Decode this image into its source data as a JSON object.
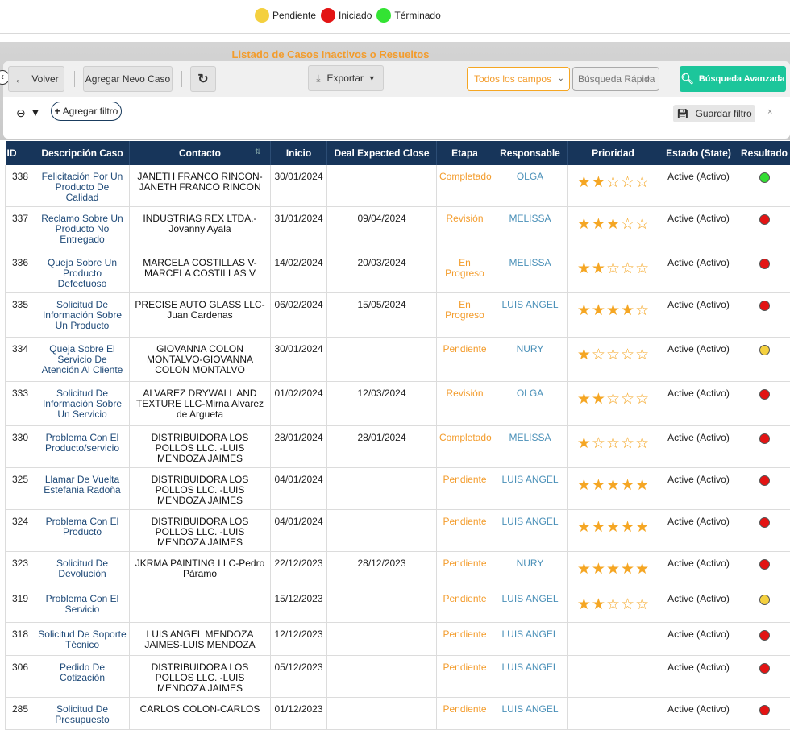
{
  "legend": [
    {
      "label": "Pendiente",
      "color": "#f4d03f"
    },
    {
      "label": "Iniciado",
      "color": "#e31414"
    },
    {
      "label": "Términado",
      "color": "#33e333"
    }
  ],
  "page_title": "Listado de Casos Inactivos o Resueltos",
  "toolbar": {
    "back_label": "Volver",
    "add_case_label": "Agregar Nevo Caso",
    "export_label": "Exportar",
    "fields_select_value": "Todos los campos",
    "quick_search_placeholder": "Búsqueda Rápida",
    "advanced_search_label": "Búsqueda Avanzada"
  },
  "filters": {
    "add_filter_label": "Agregar filtro",
    "save_filter_label": "Guardar filtro"
  },
  "table": {
    "columns": [
      "ID",
      "Descripción Caso",
      "Contacto",
      "Inicio",
      "Deal Expected Close",
      "Etapa",
      "Responsable",
      "Prioridad",
      "Estado (State)",
      "Resultado"
    ],
    "rows": [
      {
        "id": "338",
        "desc": "Felicitación Por Un Producto De Calidad",
        "contact": "JANETH FRANCO RINCON-JANETH FRANCO RINCON",
        "start": "30/01/2024",
        "close": "",
        "stage": "Completado",
        "owner": "OLGA",
        "priority": 2,
        "state": "Active (Activo)",
        "result": "green"
      },
      {
        "id": "337",
        "desc": "Reclamo Sobre Un Producto No Entregado",
        "contact": "INDUSTRIAS REX LTDA.-Jovanny Ayala",
        "start": "31/01/2024",
        "close": "09/04/2024",
        "stage": "Revisión",
        "owner": "MELISSA",
        "priority": 3,
        "state": "Active (Activo)",
        "result": "red"
      },
      {
        "id": "336",
        "desc": "Queja Sobre Un Producto Defectuoso",
        "contact": "MARCELA COSTILLAS V-MARCELA COSTILLAS V",
        "start": "14/02/2024",
        "close": "20/03/2024",
        "stage": "En Progreso",
        "owner": "MELISSA",
        "priority": 2,
        "state": "Active (Activo)",
        "result": "red"
      },
      {
        "id": "335",
        "desc": "Solicitud De Información Sobre Un Producto",
        "contact": "PRECISE AUTO GLASS LLC-Juan Cardenas",
        "start": "06/02/2024",
        "close": "15/05/2024",
        "stage": "En Progreso",
        "owner": "LUIS ANGEL",
        "priority": 4,
        "state": "Active (Activo)",
        "result": "red"
      },
      {
        "id": "334",
        "desc": "Queja Sobre El Servicio De Atención Al Cliente",
        "contact": "GIOVANNA COLON MONTALVO-GIOVANNA COLON MONTALVO",
        "start": "30/01/2024",
        "close": "",
        "stage": "Pendiente",
        "owner": "NURY",
        "priority": 1,
        "state": "Active (Activo)",
        "result": "yellow"
      },
      {
        "id": "333",
        "desc": "Solicitud De Información Sobre Un Servicio",
        "contact": "ALVAREZ DRYWALL AND TEXTURE LLC-Mirna Alvarez de Argueta",
        "start": "01/02/2024",
        "close": "12/03/2024",
        "stage": "Revisión",
        "owner": "OLGA",
        "priority": 2,
        "state": "Active (Activo)",
        "result": "red"
      },
      {
        "id": "330",
        "desc": "Problema Con El Producto/servicio",
        "contact": "DISTRIBUIDORA LOS POLLOS LLC. -LUIS MENDOZA JAIMES",
        "start": "28/01/2024",
        "close": "28/01/2024",
        "stage": "Completado",
        "owner": "MELISSA",
        "priority": 1,
        "state": "Active (Activo)",
        "result": "red"
      },
      {
        "id": "325",
        "desc": "Llamar De Vuelta Estefania Radoña",
        "contact": "DISTRIBUIDORA LOS POLLOS LLC. -LUIS MENDOZA JAIMES",
        "start": "04/01/2024",
        "close": "",
        "stage": "Pendiente",
        "owner": "LUIS ANGEL",
        "priority": 5,
        "state": "Active (Activo)",
        "result": "red"
      },
      {
        "id": "324",
        "desc": "Problema Con El Producto",
        "contact": "DISTRIBUIDORA LOS POLLOS LLC. -LUIS MENDOZA JAIMES",
        "start": "04/01/2024",
        "close": "",
        "stage": "Pendiente",
        "owner": "LUIS ANGEL",
        "priority": 5,
        "state": "Active (Activo)",
        "result": "red"
      },
      {
        "id": "323",
        "desc": "Solicitud De Devolución",
        "contact": "JKRMA PAINTING LLC-Pedro Páramo",
        "start": "22/12/2023",
        "close": "28/12/2023",
        "stage": "Pendiente",
        "owner": "NURY",
        "priority": 5,
        "state": "Active (Activo)",
        "result": "red"
      },
      {
        "id": "319",
        "desc": "Problema Con El Servicio",
        "contact": "",
        "start": "15/12/2023",
        "close": "",
        "stage": "Pendiente",
        "owner": "LUIS ANGEL",
        "priority": 2,
        "state": "Active (Activo)",
        "result": "yellow"
      },
      {
        "id": "318",
        "desc": "Solicitud De Soporte Técnico",
        "contact": "LUIS ANGEL MENDOZA JAIMES-LUIS MENDOZA",
        "start": "12/12/2023",
        "close": "",
        "stage": "Pendiente",
        "owner": "LUIS ANGEL",
        "priority": 0,
        "state": "Active (Activo)",
        "result": "red"
      },
      {
        "id": "306",
        "desc": "Pedido De Cotización",
        "contact": "DISTRIBUIDORA LOS POLLOS LLC. -LUIS MENDOZA JAIMES",
        "start": "05/12/2023",
        "close": "",
        "stage": "Pendiente",
        "owner": "LUIS ANGEL",
        "priority": 0,
        "state": "Active (Activo)",
        "result": "red"
      },
      {
        "id": "285",
        "desc": "Solicitud De Presupuesto",
        "contact": "CARLOS COLON-CARLOS",
        "start": "01/12/2023",
        "close": "",
        "stage": "Pendiente",
        "owner": "LUIS ANGEL",
        "priority": 0,
        "state": "Active (Activo)",
        "result": "red"
      }
    ]
  },
  "result_colors": {
    "green": "#33dd33",
    "red": "#e31414",
    "yellow": "#f4d03f"
  }
}
